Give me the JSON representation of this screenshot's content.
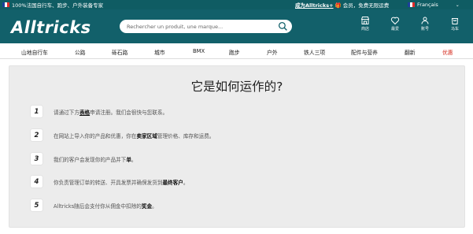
{
  "topbar": {
    "left_text": "100%法国自行车、跑步、户外装备专家",
    "promo_link": "成为Alltricks+",
    "promo_text": "会员，免费无限运费",
    "language": "Français"
  },
  "header": {
    "logo": "Alltricks",
    "search_placeholder": "Rechercher un produit, une marque...",
    "icons": [
      {
        "name": "store-icon",
        "label": "商店"
      },
      {
        "name": "heart-icon",
        "label": "最爱"
      },
      {
        "name": "account-icon",
        "label": "账号"
      },
      {
        "name": "cart-icon",
        "label": "马车"
      }
    ]
  },
  "nav": {
    "items": [
      "山地自行车",
      "公路",
      "砾石路",
      "城市",
      "BMX",
      "跑步",
      "户外",
      "铁人三项",
      "配件与营养",
      "翻新"
    ],
    "promo": "优惠"
  },
  "main": {
    "title": "它是如何运作的?",
    "steps": [
      {
        "num": "1",
        "pre": "请通过下方",
        "bold": "表格",
        "post": "申请注册。我们会很快与您联系。"
      },
      {
        "num": "2",
        "pre": "在网站上导入你的产品和优惠，你在",
        "bold": "卖家区域",
        "post": "管理价格、库存和运费。"
      },
      {
        "num": "3",
        "pre": "我们的客户会发现你的产品并下",
        "bold": "单",
        "post": "。"
      },
      {
        "num": "4",
        "pre": "你负责管理订单的转送、开具发票并确保发货到",
        "bold": "最终客户",
        "post": "。"
      },
      {
        "num": "5",
        "pre": "Alltricks随后会支付你从佣金中扣除的",
        "bold": "奖金",
        "post": "。"
      }
    ]
  },
  "colors": {
    "header": "#12606a",
    "topbar": "#0f5c63",
    "promo": "#d52b1e"
  }
}
